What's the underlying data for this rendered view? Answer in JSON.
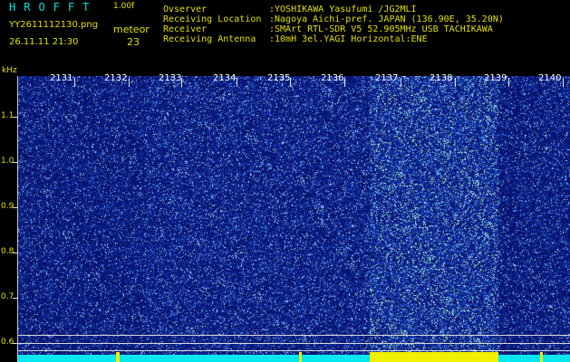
{
  "header": {
    "brand": "HROFFT",
    "version": "1.00f",
    "filename": "YY2611112130.png",
    "timestamp": "26.11.11 21:30",
    "meteor_label": "meteor",
    "meteor_count": "23"
  },
  "info": [
    {
      "key": "Ovserver",
      "value": ":YOSHIKAWA Yasufumi /JG2MLI"
    },
    {
      "key": "Receiving Location",
      "value": ":Nagoya Aichi-pref. JAPAN (136.90E, 35.20N)"
    },
    {
      "key": "Receiver",
      "value": ":SMArt RTL-SDR V5 52.905MHz USB TACHIKAWA"
    },
    {
      "key": "Receiving Antenna",
      "value": ":10mH 3el.YAGI Horizontal:ENE"
    }
  ],
  "plot": {
    "unit_label": "kHz",
    "y_ticks": [
      "1.1",
      "1.0",
      "0.9",
      "0.8",
      "0.7",
      "0.6"
    ],
    "x_ticks": [
      "2131",
      "2132",
      "2133",
      "2134",
      "2135",
      "2136",
      "2137",
      "2138",
      "2139",
      "2140"
    ],
    "colors": {
      "background": "#000000",
      "text_yellow": "#e0e000",
      "brand_cyan": "#00e0e0",
      "bottom_cyan": "#00e8f0",
      "bottom_yellow": "#f0f000"
    }
  }
}
